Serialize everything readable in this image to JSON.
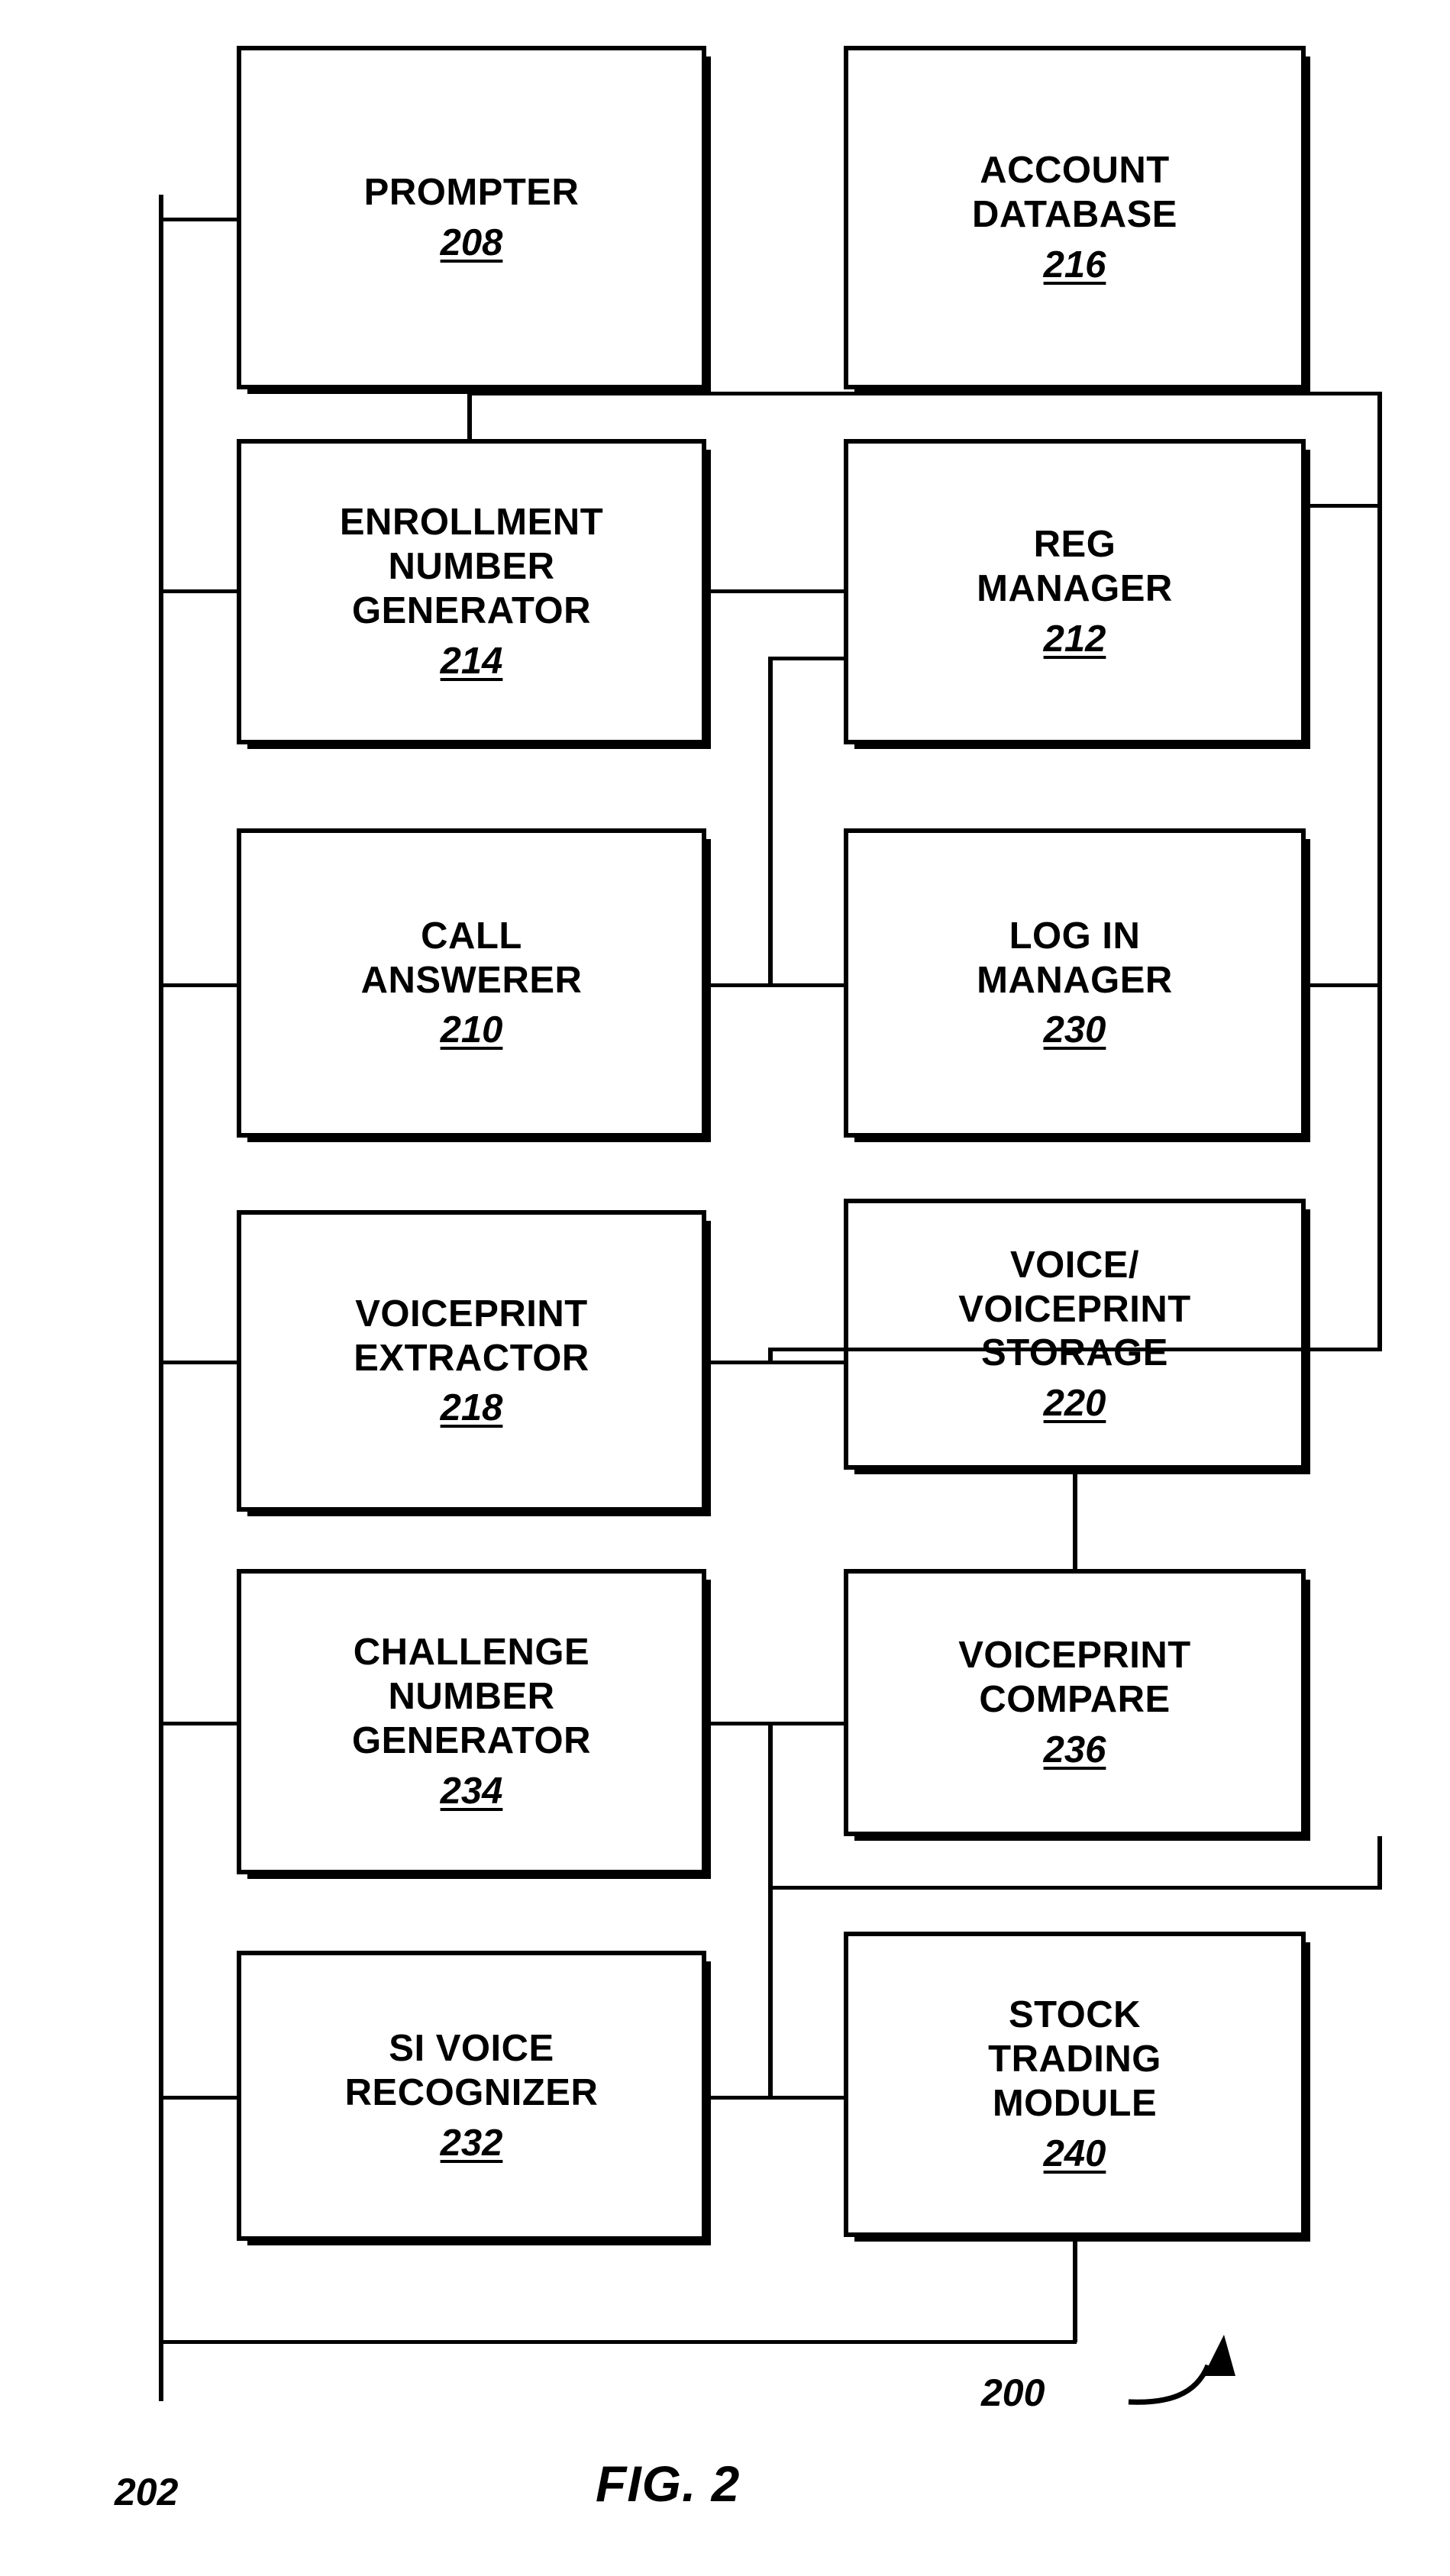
{
  "figure": {
    "caption": "FIG. 2",
    "system_label": "200",
    "bus_label": "202"
  },
  "blocks": [
    {
      "id": "prompter",
      "title": "PROMPTER",
      "num": "208",
      "col": "left",
      "row": 1
    },
    {
      "id": "account-database",
      "title": "ACCOUNT\nDATABASE",
      "num": "216",
      "col": "right",
      "row": 1
    },
    {
      "id": "enrollment-number-generator",
      "title": "ENROLLMENT\nNUMBER\nGENERATOR",
      "num": "214",
      "col": "left",
      "row": 2
    },
    {
      "id": "reg-manager",
      "title": "REG\nMANAGER",
      "num": "212",
      "col": "right",
      "row": 2
    },
    {
      "id": "call-answerer",
      "title": "CALL\nANSWERER",
      "num": "210",
      "col": "left",
      "row": 3
    },
    {
      "id": "log-in-manager",
      "title": "LOG IN\nMANAGER",
      "num": "230",
      "col": "right",
      "row": 3
    },
    {
      "id": "voiceprint-extractor",
      "title": "VOICEPRINT\nEXTRACTOR",
      "num": "218",
      "col": "left",
      "row": 4
    },
    {
      "id": "voice-voiceprint-storage",
      "title": "VOICE/\nVOICEPRINT\nSTORAGE",
      "num": "220",
      "col": "right",
      "row": 4
    },
    {
      "id": "challenge-number-generator",
      "title": "CHALLENGE\nNUMBER\nGENERATOR",
      "num": "234",
      "col": "left",
      "row": 5
    },
    {
      "id": "voiceprint-compare",
      "title": "VOICEPRINT\nCOMPARE",
      "num": "236",
      "col": "right",
      "row": 5
    },
    {
      "id": "si-voice-recognizer",
      "title": "SI VOICE\nRECOGNIZER",
      "num": "232",
      "col": "left",
      "row": 6
    },
    {
      "id": "stock-trading-module",
      "title": "STOCK\nTRADING\nMODULE",
      "num": "240",
      "col": "right",
      "row": 6
    }
  ],
  "colors": {
    "ink": "#000000",
    "paper": "#ffffff"
  }
}
